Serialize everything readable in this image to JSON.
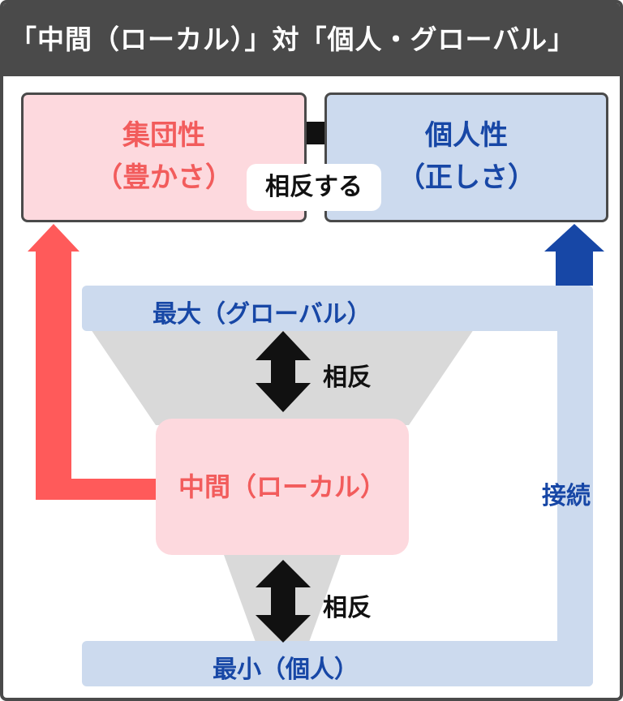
{
  "title": "「中間（ローカル）」対「個人・グローバル」",
  "collective": {
    "line1": "集団性",
    "line2": "（豊かさ）"
  },
  "individual": {
    "line1": "個人性",
    "line2": "（正しさ）"
  },
  "opposition_label": "相反する",
  "maximum_label": "最大（グローバル）",
  "middle_label": "中間（ローカル）",
  "minimum_label": "最小（個人）",
  "upper_conflict_label": "相反",
  "lower_conflict_label": "相反",
  "connection_label": "接続",
  "colors": {
    "red": "#f25c5c",
    "pink": "#fdd9de",
    "blue": "#1747a6",
    "lightblue": "#ccdaee",
    "gray": "#d9d9d9",
    "dark": "#4a4a4a"
  }
}
